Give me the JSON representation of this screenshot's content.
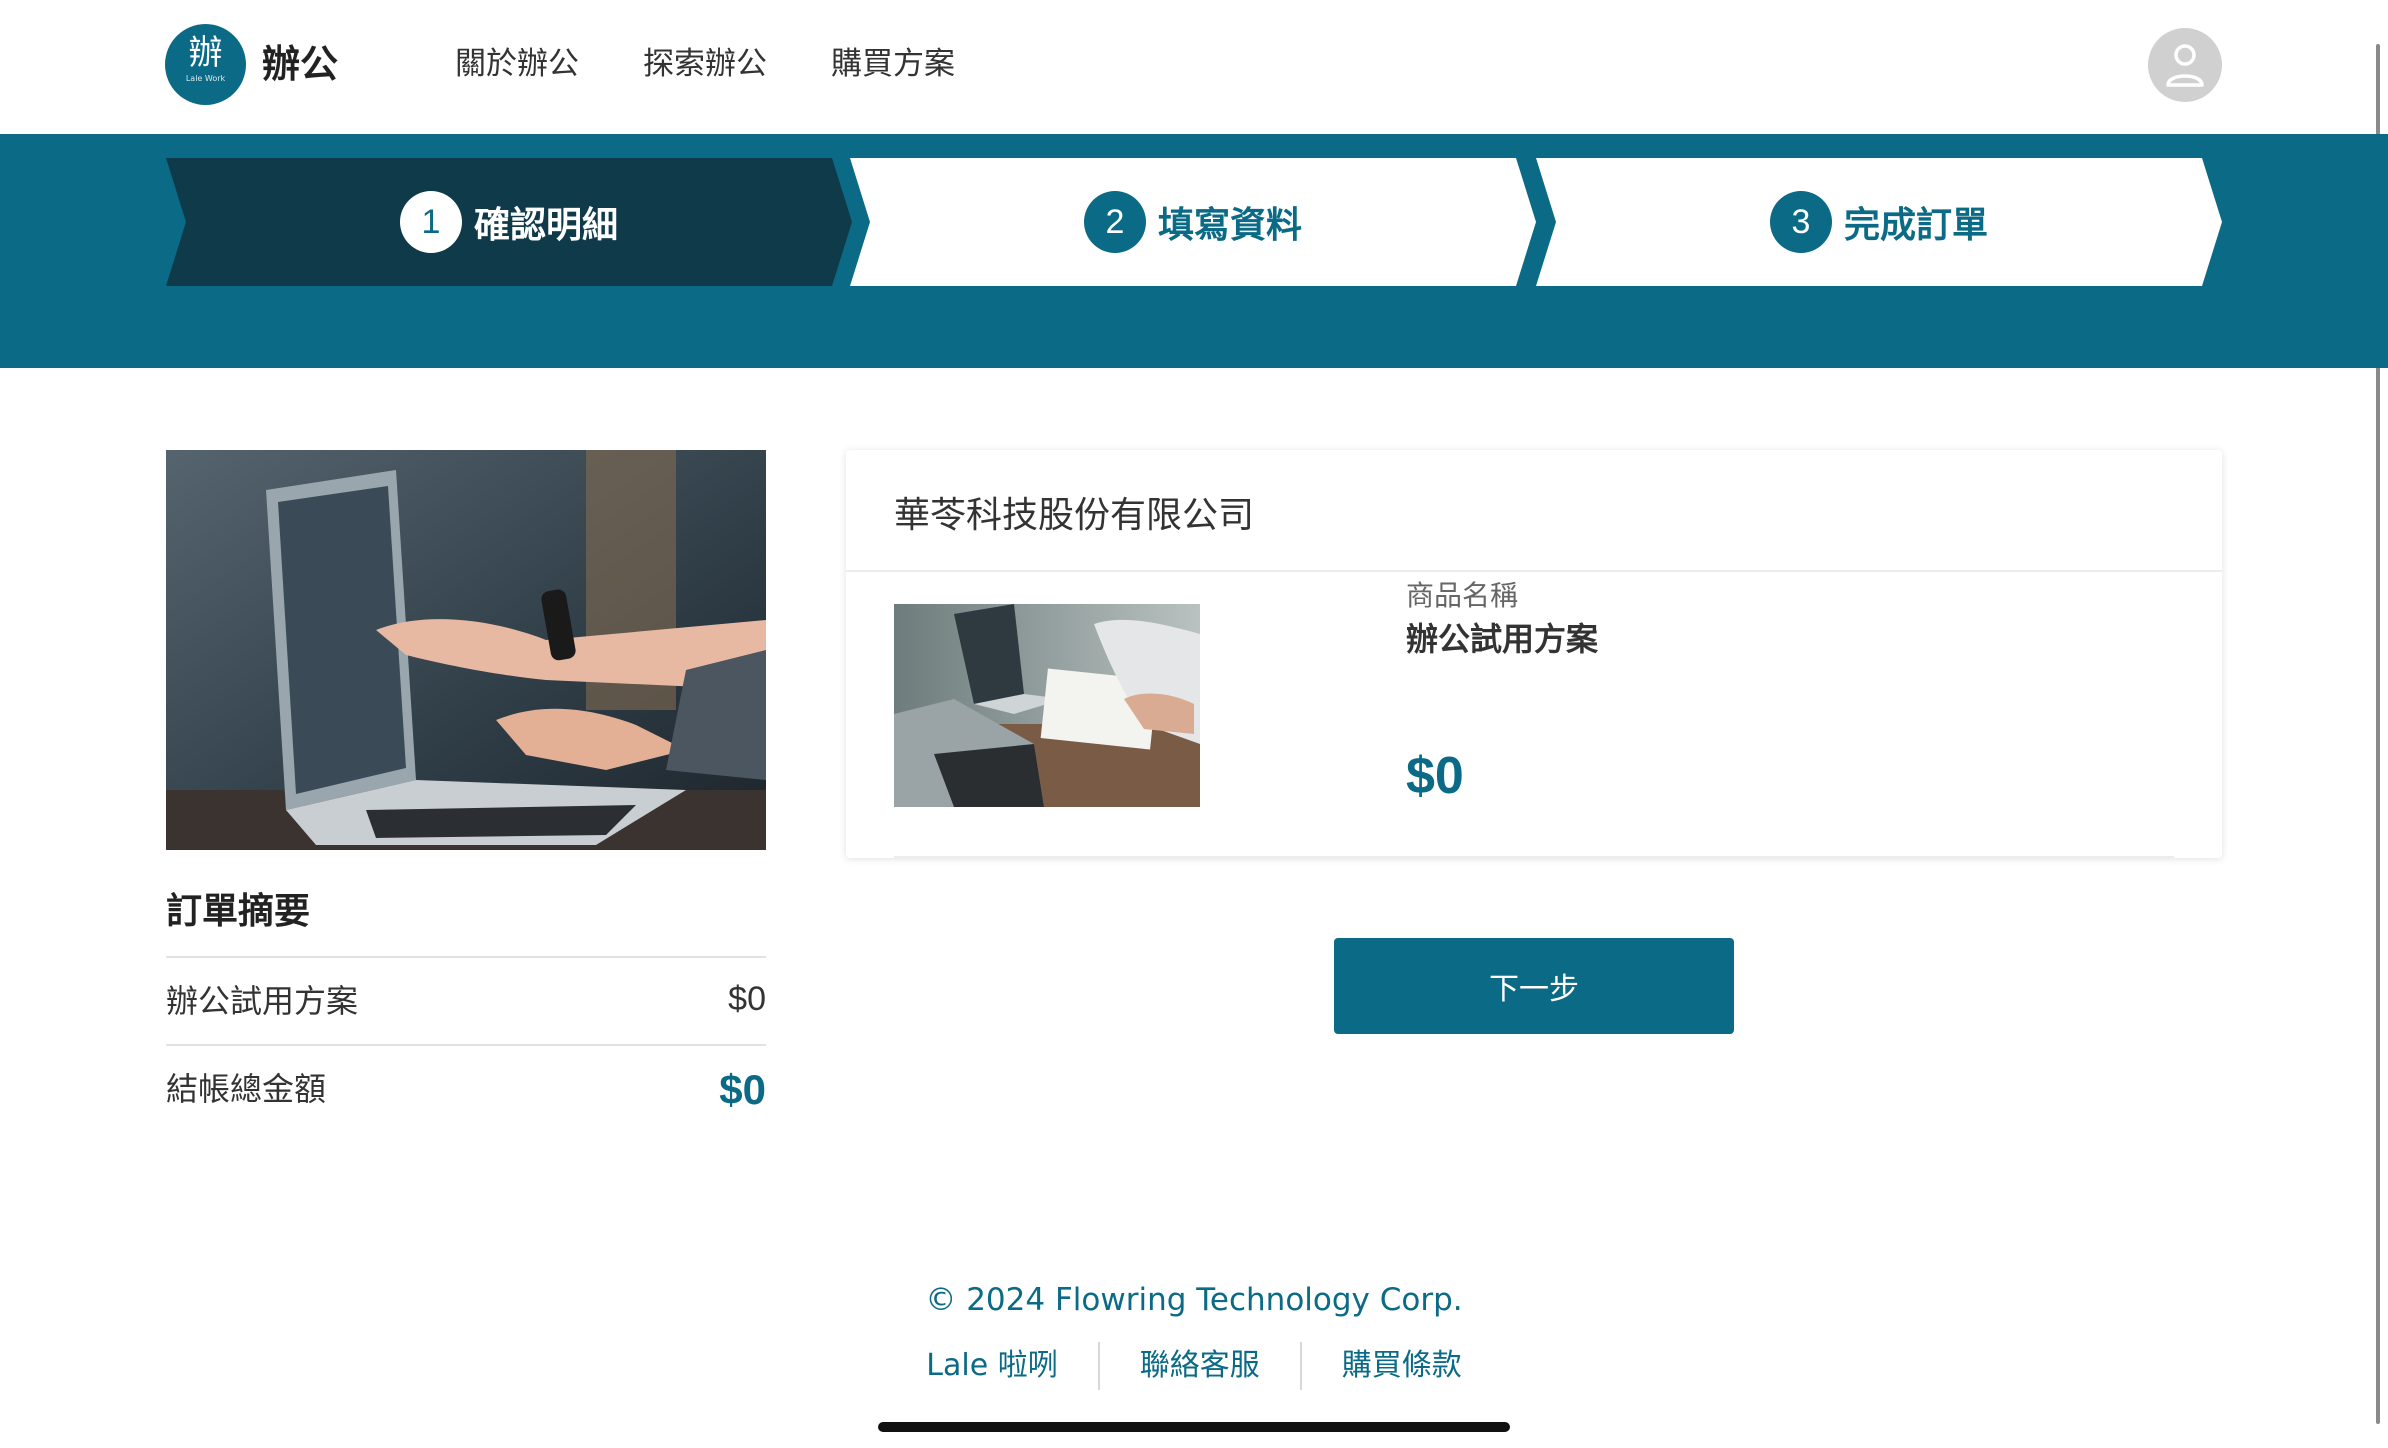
{
  "header": {
    "logo_glyph": "辦",
    "logo_small": "Lale Work",
    "logo_text": "辦公",
    "nav": [
      {
        "label": "關於辦公"
      },
      {
        "label": "探索辦公"
      },
      {
        "label": "購買方案"
      }
    ],
    "avatar_icon": "user-icon"
  },
  "stepper": {
    "steps": [
      {
        "num": "1",
        "label": "確認明細",
        "state": "active"
      },
      {
        "num": "2",
        "label": "填寫資料",
        "state": "inactive"
      },
      {
        "num": "3",
        "label": "完成訂單",
        "state": "inactive"
      }
    ],
    "active_color": "#0f3a4a",
    "band_color": "#0b6a86"
  },
  "summary": {
    "title": "訂單摘要",
    "rows": [
      {
        "name": "辦公試用方案",
        "price": "$0"
      },
      {
        "name": "結帳總金額",
        "price": "$0"
      }
    ]
  },
  "card": {
    "company": "華苓科技股份有限公司",
    "caption": "商品名稱",
    "product_name": "辦公試用方案",
    "price": "$0"
  },
  "next_button": {
    "label": "下一步"
  },
  "footer": {
    "copyright": "© 2024 Flowring Technology Corp.",
    "links": [
      {
        "label": "Lale 啦咧"
      },
      {
        "label": "聯絡客服"
      },
      {
        "label": "購買條款"
      }
    ]
  }
}
